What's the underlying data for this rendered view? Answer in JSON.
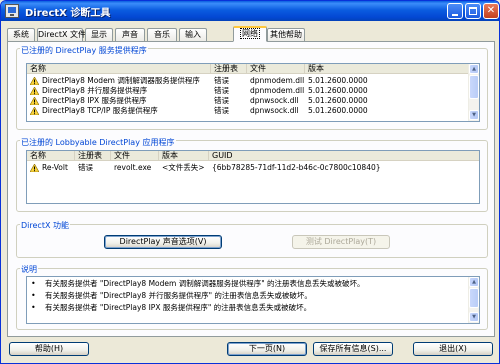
{
  "window": {
    "title": "DirectX 诊断工具"
  },
  "tabs": [
    {
      "label": "系统"
    },
    {
      "label": "DirectX 文件"
    },
    {
      "label": "显示"
    },
    {
      "label": "声音"
    },
    {
      "label": "音乐"
    },
    {
      "label": "输入"
    },
    {
      "label": "网络"
    },
    {
      "label": "其他帮助"
    }
  ],
  "active_tab": "网络",
  "providers": {
    "title": "已注册的 DirectPlay 服务提供程序",
    "columns": [
      "名称",
      "注册表",
      "文件",
      "版本"
    ],
    "rows": [
      {
        "name": "DirectPlay8 Modem 调制解调器服务提供程序",
        "registry": "错误",
        "file": "dpnmodem.dll",
        "version": "5.01.2600.0000"
      },
      {
        "name": "DirectPlay8 并行服务提供程序",
        "registry": "错误",
        "file": "dpnmodem.dll",
        "version": "5.01.2600.0000"
      },
      {
        "name": "DirectPlay8 IPX 服务提供程序",
        "registry": "错误",
        "file": "dpnwsock.dll",
        "version": "5.01.2600.0000"
      },
      {
        "name": "DirectPlay8 TCP/IP 服务提供程序",
        "registry": "错误",
        "file": "dpnwsock.dll",
        "version": "5.01.2600.0000"
      }
    ]
  },
  "lobbyable": {
    "title": "已注册的 Lobbyable DirectPlay 应用程序",
    "columns": [
      "名称",
      "注册表",
      "文件",
      "版本",
      "GUID"
    ],
    "rows": [
      {
        "name": "Re-Volt",
        "registry": "错误",
        "file": "revolt.exe",
        "version": "<文件丢失>",
        "guid": "{6bb78285-71df-11d2-b46c-0c7800c10840}"
      }
    ]
  },
  "directx_features": {
    "title": "DirectX 功能",
    "voice_button": "DirectPlay 声音选项(V)",
    "test_button": "测试 DirectPlay(T)"
  },
  "notes": {
    "title": "说明",
    "items": [
      "有关服务提供者 \"DirectPlay8 Modem 调制解调器服务提供程序\" 的注册表信息丢失或被破坏。",
      "有关服务提供者 \"DirectPlay8 并行服务提供程序\" 的注册表信息丢失或被破坏。",
      "有关服务提供者 \"DirectPlay8 IPX 服务提供程序\" 的注册表信息丢失或被破坏。"
    ]
  },
  "footer": {
    "help": "帮助(H)",
    "next_page": "下一页(N)",
    "save_all": "保存所有信息(S)...",
    "exit": "退出(X)"
  }
}
